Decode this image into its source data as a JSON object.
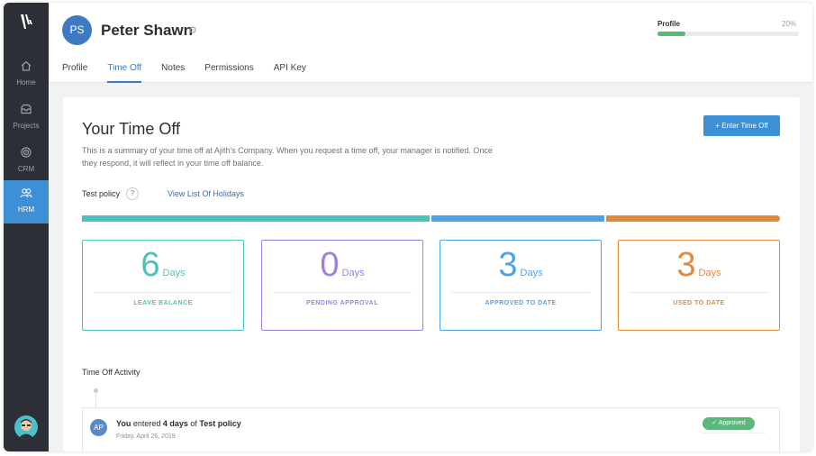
{
  "sidebar": {
    "items": [
      {
        "label": "Home",
        "icon": "home-icon"
      },
      {
        "label": "Projects",
        "icon": "inbox-icon"
      },
      {
        "label": "CRM",
        "icon": "target-icon"
      },
      {
        "label": "HRM",
        "icon": "users-icon"
      }
    ],
    "active": "HRM"
  },
  "header": {
    "avatar_initials": "PS",
    "user_name": "Peter Shawn",
    "tabs": [
      "Profile",
      "Time Off",
      "Notes",
      "Permissions",
      "API Key"
    ],
    "active_tab": "Time Off",
    "profile": {
      "label": "Profile",
      "percent_text": "20%",
      "progress": 0.2
    }
  },
  "time_off": {
    "title": "Your Time Off",
    "description": "This is a summary of your time off at Ajith's Company. When you request a time off, your manager is notified. Once they respond, it will reflect in your time off balance.",
    "enter_button": "+ Enter Time Off",
    "policy_label": "Test policy",
    "help_label": "?",
    "holidays_link": "View List Of Holidays",
    "boxes": [
      {
        "value": "6",
        "unit": "Days",
        "caption": "LEAVE BALANCE",
        "color": "#4cc2bb"
      },
      {
        "value": "0",
        "unit": "Days",
        "caption": "PENDING APPROVAL",
        "color": "#a07fe0"
      },
      {
        "value": "3",
        "unit": "Days",
        "caption": "APPROVED TO DATE",
        "color": "#4ea3e6"
      },
      {
        "value": "3",
        "unit": "Days",
        "caption": "USED TO DATE",
        "color": "#e28a3a"
      }
    ]
  },
  "activity": {
    "title": "Time Off Activity",
    "items": [
      {
        "avatar": "AP",
        "actor": "You",
        "verb": " entered ",
        "amount": "4 days",
        "prep": " of ",
        "policy": "Test policy",
        "date": "Friday, April 26, 2019",
        "status": "✓ Approved"
      }
    ]
  },
  "colors": {
    "accent": "#3d8fd6",
    "sidebar_bg": "#2c2f36",
    "approved": "#5cb87a"
  }
}
